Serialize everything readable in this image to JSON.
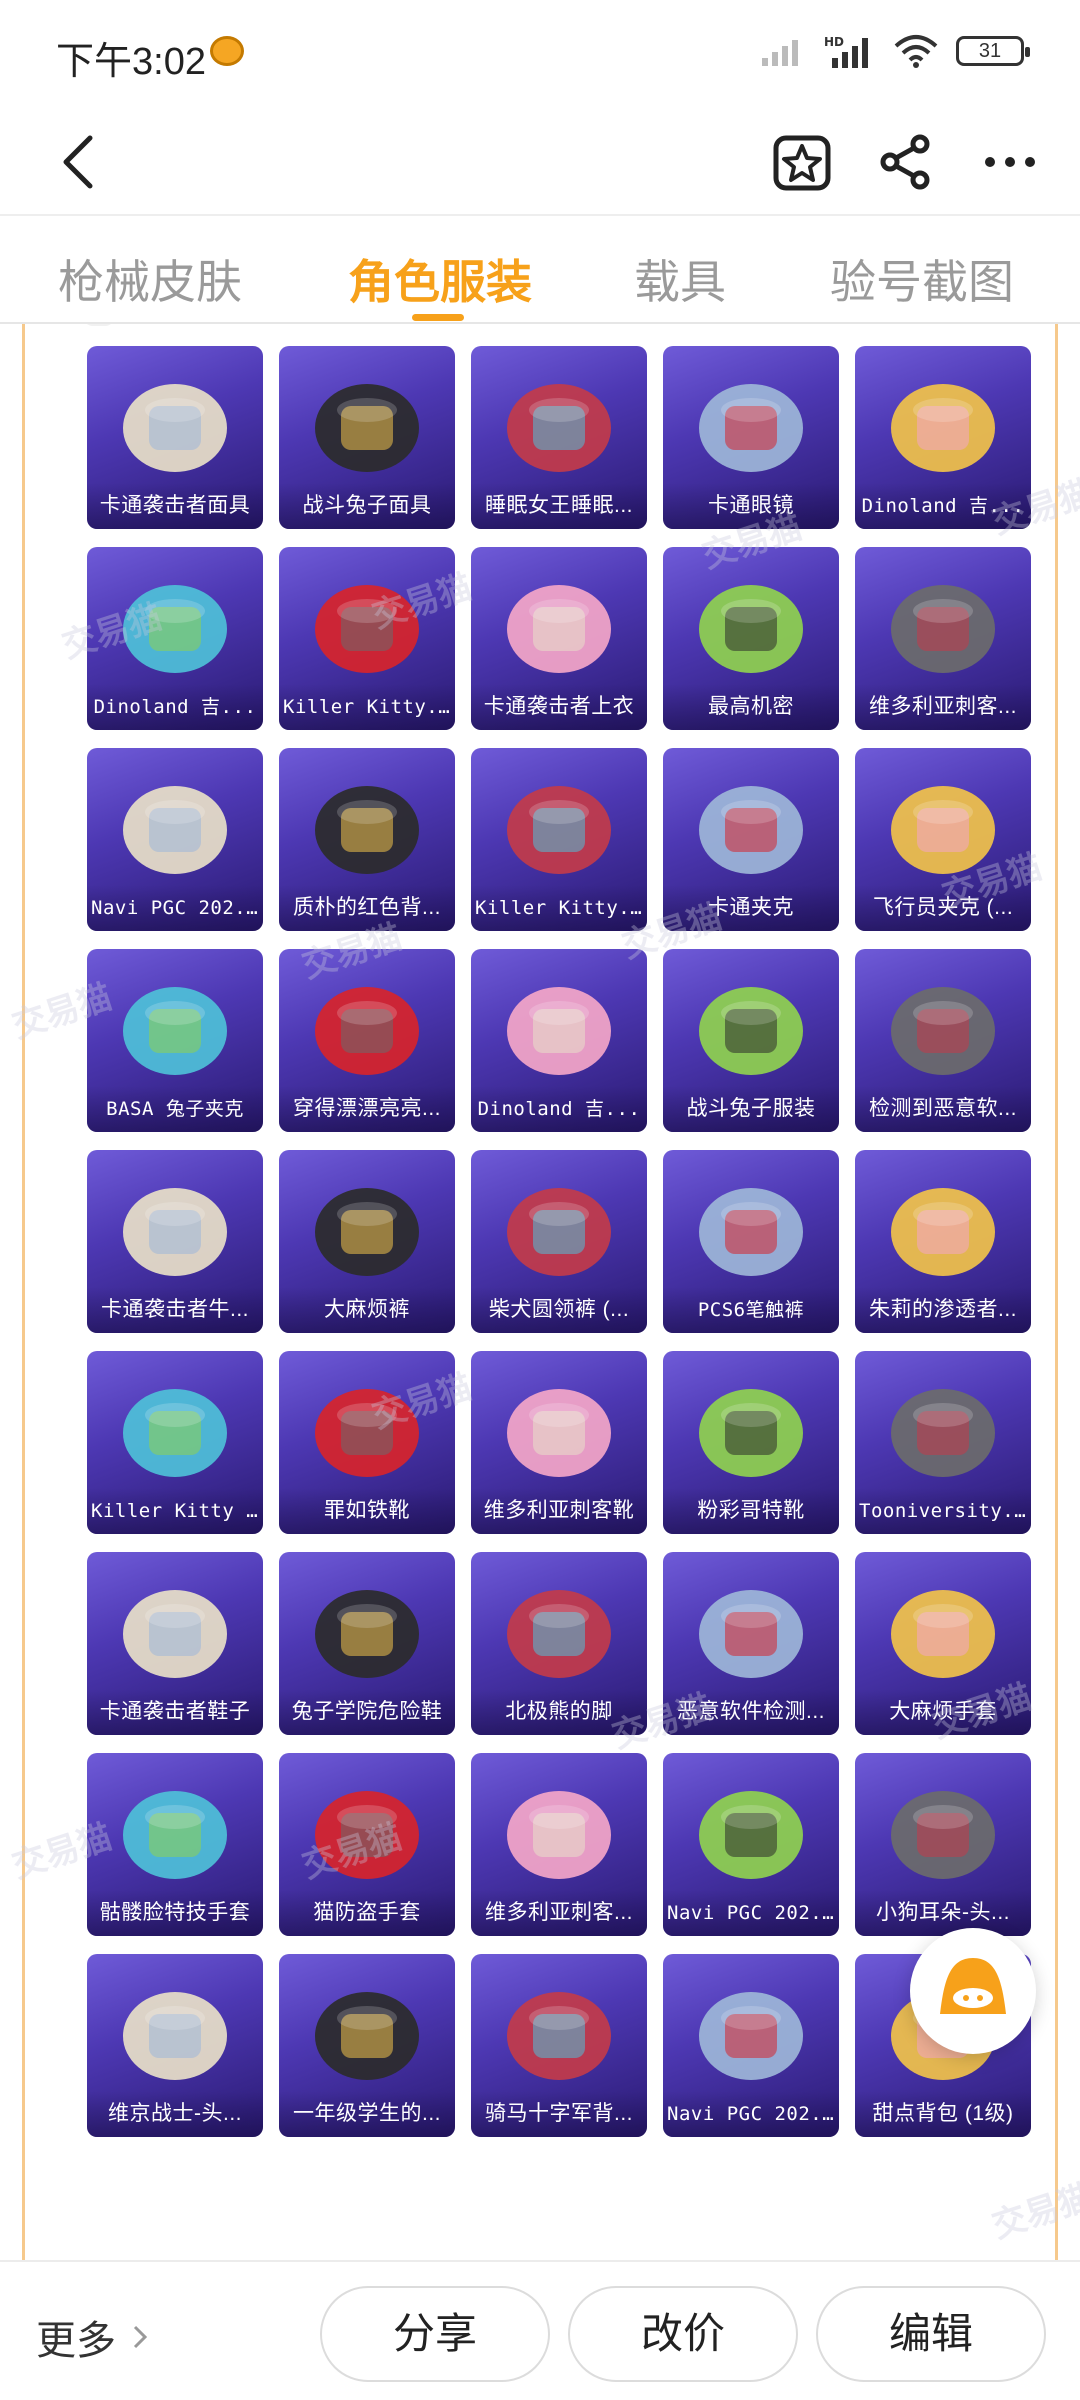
{
  "status_bar": {
    "time": "下午3:02",
    "battery": "31"
  },
  "nav": {
    "back_icon": "chevron-left-icon",
    "favorite_icon": "star-box-icon",
    "share_icon": "share-icon",
    "more_icon": "more-dots-icon"
  },
  "tabs": [
    {
      "label": "枪械皮肤",
      "active": false
    },
    {
      "label": "角色服装",
      "active": true
    },
    {
      "label": "载具",
      "active": false
    },
    {
      "label": "验号截图",
      "active": false
    }
  ],
  "accent_color": "#f7a11a",
  "watermark": "交易猫",
  "items": [
    [
      "卡通袭击者面具",
      "战斗兔子面具",
      "睡眠女王睡眠...",
      "卡通眼镜",
      "Dinoland 吉..."
    ],
    [
      "Dinoland 吉...",
      "Killer Kitty...",
      "卡通袭击者上衣",
      "最高机密",
      "维多利亚刺客..."
    ],
    [
      "Navi PGC 202...",
      "质朴的红色背...",
      "Killer Kitty...",
      "卡通夹克",
      "飞行员夹克 (..."
    ],
    [
      "BASA 兔子夹克",
      "穿得漂漂亮亮...",
      "Dinoland 吉...",
      "战斗兔子服装",
      "检测到恶意软..."
    ],
    [
      "卡通袭击者牛...",
      "大麻烦裤",
      "柴犬圆领裤 (...",
      "PCS6笔触裤",
      "朱莉的渗透者..."
    ],
    [
      "Killer Kitty 裙",
      "罪如铁靴",
      "维多利亚刺客靴",
      "粉彩哥特靴",
      "Tooniversity..."
    ],
    [
      "卡通袭击者鞋子",
      "兔子学院危险鞋",
      "北极熊的脚",
      "恶意软件检测...",
      "大麻烦手套"
    ],
    [
      "骷髅脸特技手套",
      "猫防盗手套",
      "维多利亚刺客...",
      "Navi PGC 202...",
      "小狗耳朵-头..."
    ],
    [
      "维京战士-头...",
      "一年级学生的...",
      "骑马十字军背...",
      "Navi PGC 202...",
      "甜点背包 (1级)"
    ]
  ],
  "bottom_bar": {
    "more": "更多",
    "share": "分享",
    "reprice": "改价",
    "edit": "编辑"
  }
}
